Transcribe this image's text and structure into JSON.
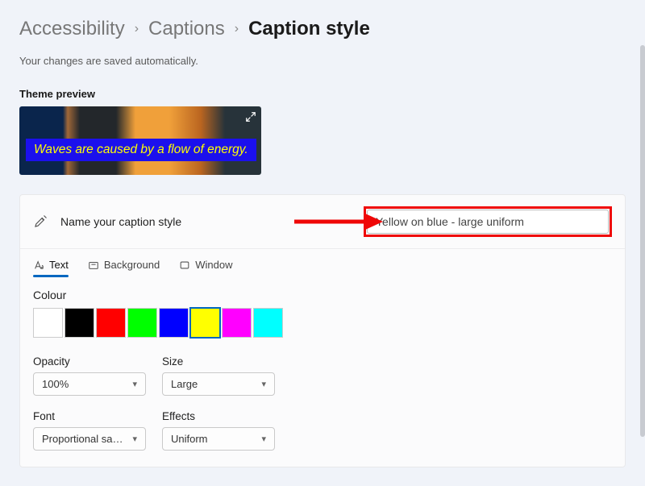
{
  "breadcrumb": {
    "items": [
      "Accessibility",
      "Captions",
      "Caption style"
    ]
  },
  "save_note": "Your changes are saved automatically.",
  "preview": {
    "label": "Theme preview",
    "caption_text": "Waves are caused by a flow of energy."
  },
  "name_row": {
    "prompt": "Name your caption style",
    "value": "Yellow on blue - large uniform"
  },
  "tabs": [
    {
      "label": "Text",
      "icon": "text-icon",
      "active": true
    },
    {
      "label": "Background",
      "icon": "background-icon",
      "active": false
    },
    {
      "label": "Window",
      "icon": "window-icon",
      "active": false
    }
  ],
  "colour": {
    "label": "Colour",
    "swatches": [
      {
        "hex": "#ffffff",
        "selected": false
      },
      {
        "hex": "#000000",
        "selected": false
      },
      {
        "hex": "#ff0000",
        "selected": false
      },
      {
        "hex": "#00ff00",
        "selected": false
      },
      {
        "hex": "#0000ff",
        "selected": false
      },
      {
        "hex": "#ffff00",
        "selected": true
      },
      {
        "hex": "#ff00ff",
        "selected": false
      },
      {
        "hex": "#00ffff",
        "selected": false
      }
    ]
  },
  "controls": {
    "opacity": {
      "label": "Opacity",
      "value": "100%"
    },
    "size": {
      "label": "Size",
      "value": "Large"
    },
    "font": {
      "label": "Font",
      "value": "Proportional san..."
    },
    "effects": {
      "label": "Effects",
      "value": "Uniform"
    }
  }
}
